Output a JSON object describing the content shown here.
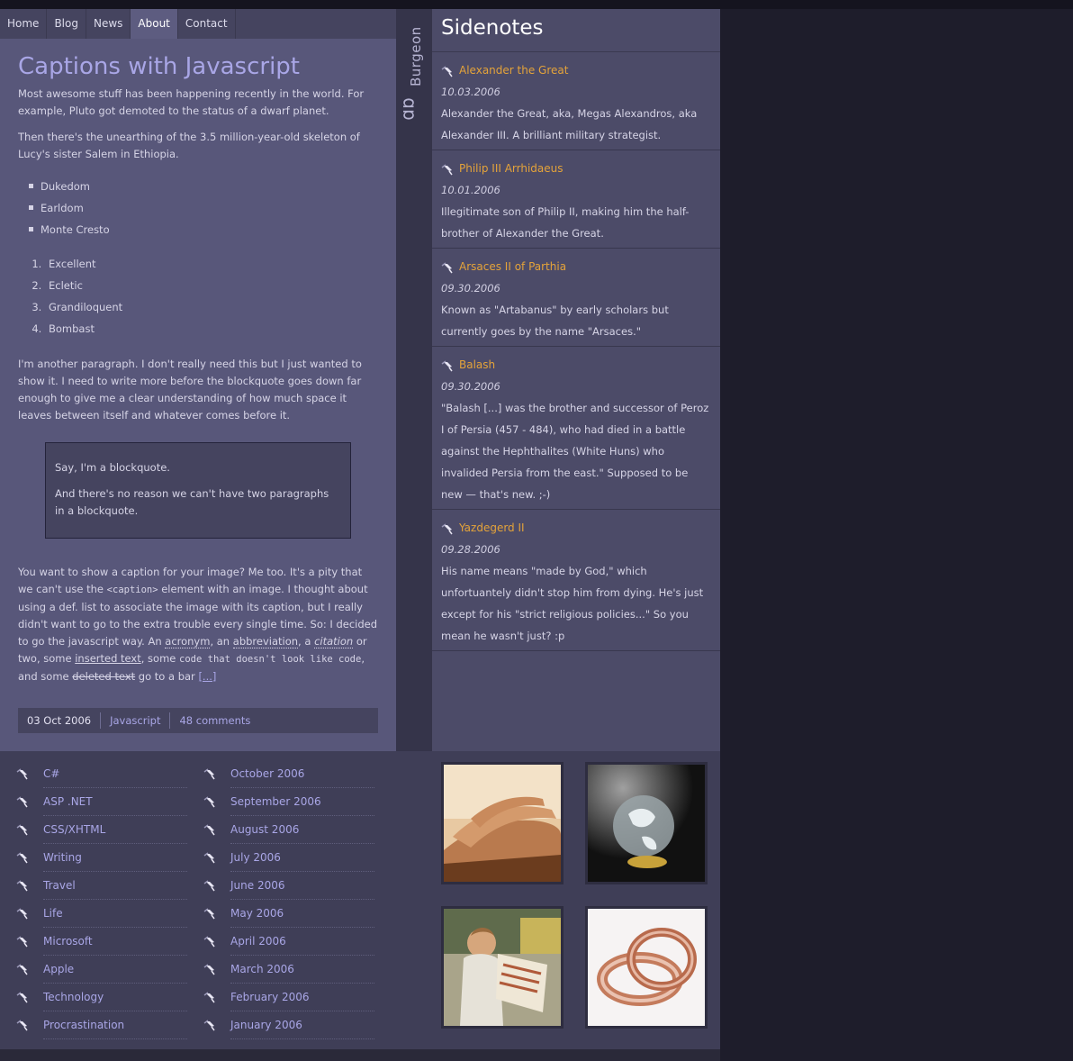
{
  "nav": {
    "items": [
      "Home",
      "Blog",
      "News",
      "About",
      "Contact"
    ],
    "active": 3
  },
  "post": {
    "title": "Captions with Javascript",
    "p1": "Most awesome stuff has been happening recently in the world. For example, Pluto got demoted to the status of a dwarf planet.",
    "p2": "Then there's the unearthing of the 3.5 million-year-old skeleton of Lucy's sister Salem in Ethiopia.",
    "bullets": [
      "Dukedom",
      "Earldom",
      "Monte Cresto"
    ],
    "numbered": [
      "Excellent",
      "Ecletic",
      "Grandiloquent",
      "Bombast"
    ],
    "p3": "I'm another paragraph. I don't really need this but I just wanted to show it. I need to write more before the blockquote goes down far enough to give me a clear understanding of how much space it leaves between itself and whatever comes before it.",
    "quote1": "Say, I'm a blockquote.",
    "quote2": "And there's no reason we can't have two paragraphs in a blockquote.",
    "p4_a": "You want to show a caption for your image? Me too. It's a pity that we can't use the ",
    "p4_code": "<caption>",
    "p4_b": " element with an image. I thought about using a def. list to associate the image with its caption, but I really didn't want to go to the extra trouble every single time. So: I decided to go the javascript way. An ",
    "p4_acronym": "acronym",
    "p4_c": ", an ",
    "p4_abbr": "abbreviation",
    "p4_d": ", a ",
    "p4_cite": "citation",
    "p4_e": " or two, some ",
    "p4_ins": "inserted text",
    "p4_f": ", some ",
    "p4_code2": "code that doesn't look like code",
    "p4_g": ", and some ",
    "p4_del": "deleted text",
    "p4_h": " go to a bar ",
    "p4_more": "[...]",
    "date": "03 Oct 2006",
    "category": "Javascript",
    "comments": "48 comments"
  },
  "logo": {
    "name": "Burgeon",
    "mark": "db"
  },
  "sidenotes": {
    "title": "Sidenotes",
    "items": [
      {
        "title": "Alexander the Great",
        "date": "10.03.2006",
        "body": "Alexander the Great, aka, Megas Alexandros, aka Alexander III. A brilliant military strategist."
      },
      {
        "title": "Philip III Arrhidaeus",
        "date": "10.01.2006",
        "body": "Illegitimate son of Philip II, making him the half-brother of Alexander the Great."
      },
      {
        "title": "Arsaces II of Parthia",
        "date": "09.30.2006",
        "body": "Known as \"Artabanus\" by early scholars but currently goes by the name \"Arsaces.\""
      },
      {
        "title": "Balash",
        "date": "09.30.2006",
        "body": "\"Balash [...] was the brother and successor of Peroz I of Persia (457 - 484), who had died in a battle against the Hephthalites (White Huns) who invalided Persia from the east.\" Supposed to be new — that's new. ;-)"
      },
      {
        "title": "Yazdegerd II",
        "date": "09.28.2006",
        "body": "His name means \"made by God,\" which unfortuantely didn't stop him from dying. He's just except for his \"strict religious policies...\" So you mean he wasn't just? :p"
      }
    ]
  },
  "categories": [
    "C#",
    "ASP .NET",
    "CSS/XHTML",
    "Writing",
    "Travel",
    "Life",
    "Microsoft",
    "Apple",
    "Technology",
    "Procrastination"
  ],
  "archives": [
    "October 2006",
    "September 2006",
    "August 2006",
    "July 2006",
    "June 2006",
    "May 2006",
    "April 2006",
    "March 2006",
    "February 2006",
    "January 2006"
  ],
  "photos": [
    "hands-photo",
    "globe-photo",
    "child-reading-photo",
    "rings-photo"
  ],
  "colors": {
    "accent": "#a9a6e6",
    "note_title": "#e4a33a",
    "main_bg": "#58577a",
    "side_bg": "#4c4b68"
  }
}
